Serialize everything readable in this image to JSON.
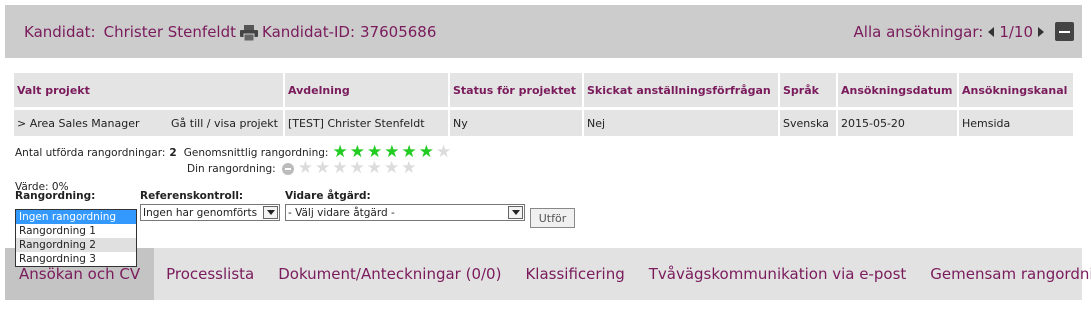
{
  "header": {
    "candidate_label": "Kandidat:",
    "candidate_name": "Christer Stenfeldt",
    "candidate_id_label": "Kandidat-ID:",
    "candidate_id": "37605686",
    "applications_label": "Alla ansökningar:",
    "pager": "1/10"
  },
  "project_table": {
    "columns": [
      "Valt projekt",
      "Avdelning",
      "Status för projektet",
      "Skickat anställningsförfrågan",
      "Språk",
      "Ansökningsdatum",
      "Ansökningskanal"
    ],
    "row": {
      "project": "> Area Sales Manager",
      "goto": "Gå till / visa projekt",
      "department": "[TEST] Christer Stenfeldt",
      "status": "Ny",
      "sent_request": "Nej",
      "language": "Svenska",
      "date": "2015-05-20",
      "channel": "Hemsida"
    }
  },
  "rating": {
    "count_label": "Antal utförda rangordningar:",
    "count": "2",
    "avg_label": "Genomsnittlig rangordning:",
    "avg_stars": 6,
    "total_stars": 7,
    "your_label": "Din rangordning:",
    "your_stars": 0,
    "value_label": "Värde: 0%"
  },
  "controls": {
    "ranking_label": "Rangordning:",
    "ranking_options": [
      "Ingen rangordning",
      "Rangordning 1",
      "Rangordning 2",
      "Rangordning 3"
    ],
    "reference_label": "Referenskontroll:",
    "reference_value": "Ingen har genomförts",
    "further_label": "Vidare åtgärd:",
    "further_value": "- Välj vidare åtgärd -",
    "execute_button": "Utför"
  },
  "tabs": [
    "Ansökan och CV",
    "Processlista",
    "Dokument/Anteckningar (0/0)",
    "Klassificering",
    "Tvåvägskommunikation via e-post",
    "Gemensam rangordning"
  ],
  "colors": {
    "accent": "#7a1b5c",
    "star_on": "#22cc22",
    "star_off": "#dcdcdc",
    "selected_option": "#3399ff"
  }
}
